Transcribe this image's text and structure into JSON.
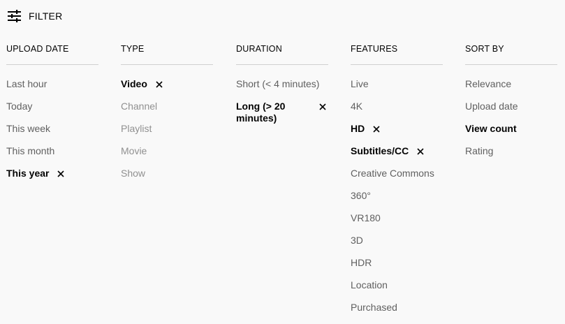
{
  "header": {
    "filter_label": "FILTER",
    "icon": "tune-icon"
  },
  "columns": [
    {
      "title": "UPLOAD DATE",
      "options": [
        {
          "label": "Last hour",
          "state": "normal"
        },
        {
          "label": "Today",
          "state": "normal"
        },
        {
          "label": "This week",
          "state": "normal"
        },
        {
          "label": "This month",
          "state": "normal"
        },
        {
          "label": "This year",
          "state": "selected"
        }
      ]
    },
    {
      "title": "TYPE",
      "options": [
        {
          "label": "Video",
          "state": "selected"
        },
        {
          "label": "Channel",
          "state": "disabled"
        },
        {
          "label": "Playlist",
          "state": "disabled"
        },
        {
          "label": "Movie",
          "state": "disabled"
        },
        {
          "label": "Show",
          "state": "disabled"
        }
      ]
    },
    {
      "title": "DURATION",
      "options": [
        {
          "label": "Short (< 4 minutes)",
          "state": "normal"
        },
        {
          "label": "Long (> 20 minutes)",
          "state": "selected"
        }
      ]
    },
    {
      "title": "FEATURES",
      "options": [
        {
          "label": "Live",
          "state": "normal"
        },
        {
          "label": "4K",
          "state": "normal"
        },
        {
          "label": "HD",
          "state": "selected"
        },
        {
          "label": "Subtitles/CC",
          "state": "selected"
        },
        {
          "label": "Creative Commons",
          "state": "normal"
        },
        {
          "label": "360°",
          "state": "normal"
        },
        {
          "label": "VR180",
          "state": "normal"
        },
        {
          "label": "3D",
          "state": "normal"
        },
        {
          "label": "HDR",
          "state": "normal"
        },
        {
          "label": "Location",
          "state": "normal"
        },
        {
          "label": "Purchased",
          "state": "normal"
        }
      ]
    },
    {
      "title": "SORT BY",
      "options": [
        {
          "label": "Relevance",
          "state": "normal"
        },
        {
          "label": "Upload date",
          "state": "normal"
        },
        {
          "label": "View count",
          "state": "sortsel"
        },
        {
          "label": "Rating",
          "state": "normal"
        }
      ]
    }
  ],
  "colors": {
    "background": "#f9f9f9",
    "text_primary": "#030303",
    "text_secondary": "#606060",
    "text_disabled": "#909090",
    "divider": "#d0d0d0"
  }
}
